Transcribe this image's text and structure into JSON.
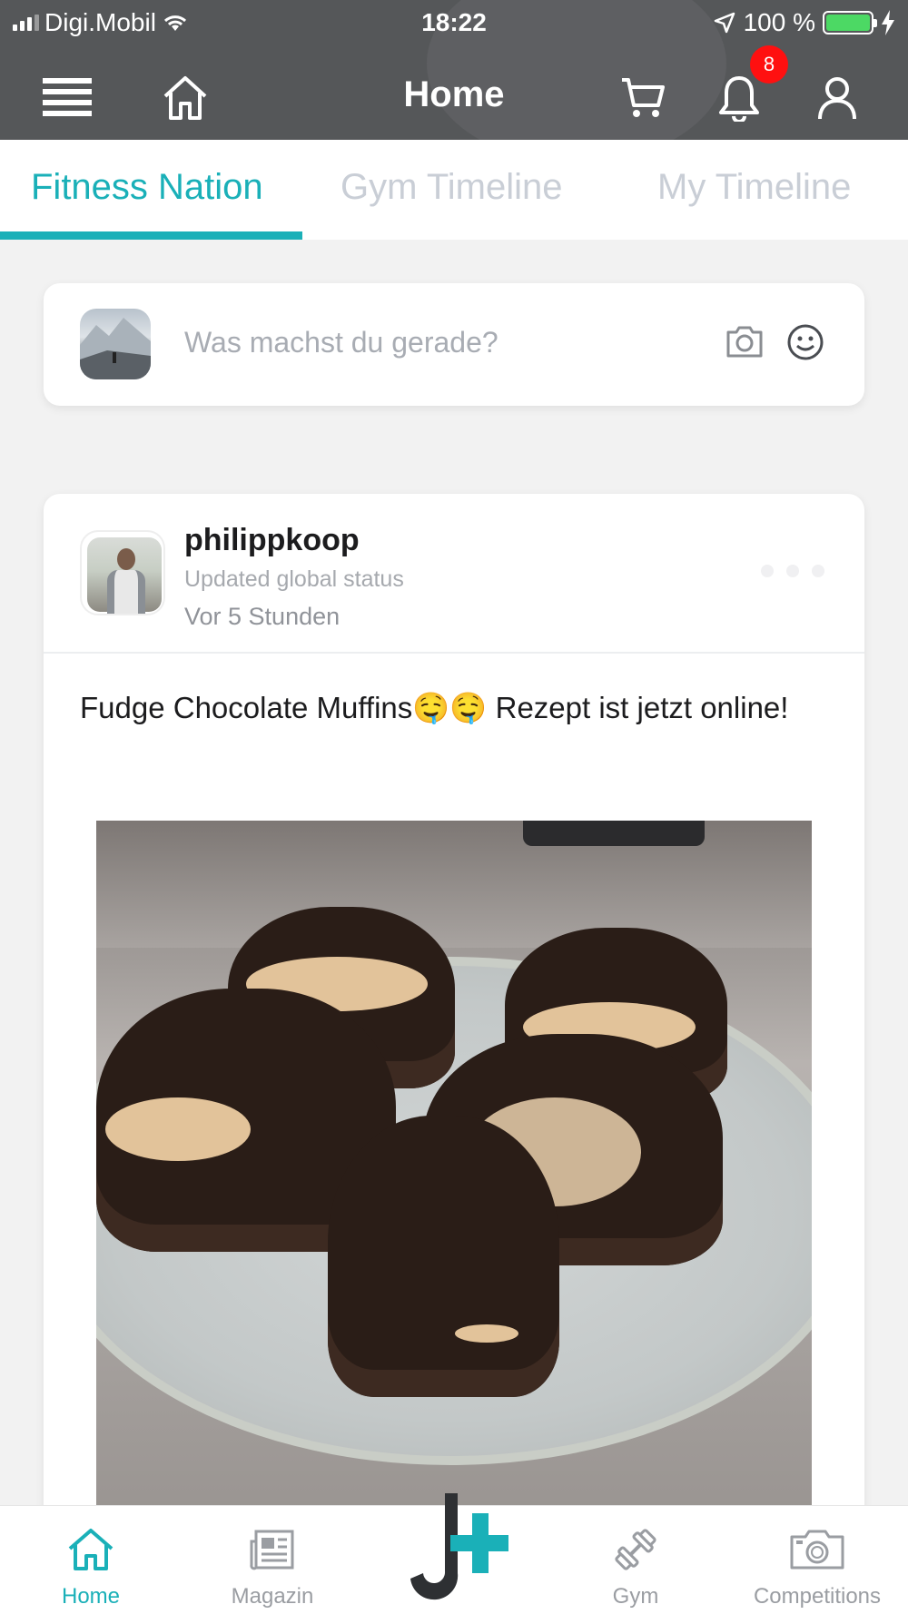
{
  "status_bar": {
    "carrier": "Digi.Mobil",
    "time": "18:22",
    "battery": "100 %"
  },
  "header": {
    "title": "Home",
    "notification_count": "8"
  },
  "tabs": [
    {
      "label": "Fitness Nation",
      "active": true
    },
    {
      "label": "Gym Timeline",
      "active": false
    },
    {
      "label": "My Timeline",
      "active": false
    }
  ],
  "composer": {
    "placeholder": "Was machst du gerade?"
  },
  "post": {
    "username": "philippkoop",
    "status_line": "Updated global status",
    "time_ago": "Vor 5 Stunden",
    "text": "Fudge Chocolate Muffins🤤🤤 Rezept ist jetzt online!"
  },
  "bottom_nav": [
    {
      "label": "Home",
      "icon": "home-icon",
      "active": true
    },
    {
      "label": "Magazin",
      "icon": "newspaper-icon",
      "active": false
    },
    {
      "label": "",
      "icon": "jplus-logo-icon",
      "active": false
    },
    {
      "label": "Gym",
      "icon": "dumbbell-icon",
      "active": false
    },
    {
      "label": "Competitions",
      "icon": "camera-icon",
      "active": false
    }
  ],
  "colors": {
    "accent": "#1ab0b8",
    "header_bg": "#555759",
    "badge": "#ff1010",
    "battery": "#4cd964"
  }
}
